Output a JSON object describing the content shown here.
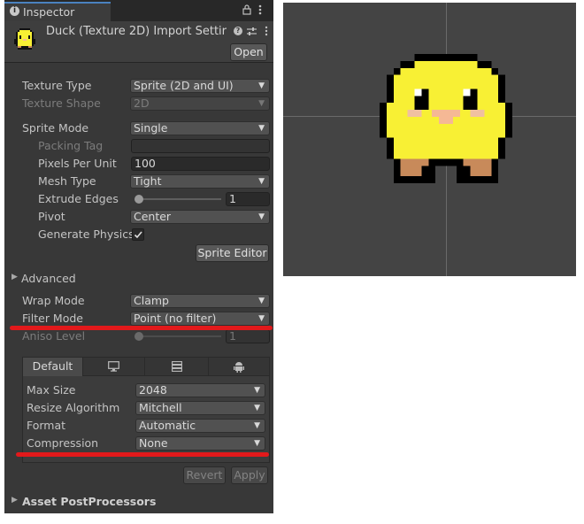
{
  "tab": {
    "icon": "info-icon",
    "title": "Inspector"
  },
  "header": {
    "title": "Duck (Texture 2D) Import Settir",
    "open_label": "Open"
  },
  "fields": {
    "texture_type": {
      "label": "Texture Type",
      "value": "Sprite (2D and UI)"
    },
    "texture_shape": {
      "label": "Texture Shape",
      "value": "2D"
    },
    "sprite_mode": {
      "label": "Sprite Mode",
      "value": "Single"
    },
    "packing_tag": {
      "label": "Packing Tag",
      "value": ""
    },
    "pixels_per_unit": {
      "label": "Pixels Per Unit",
      "value": "100"
    },
    "mesh_type": {
      "label": "Mesh Type",
      "value": "Tight"
    },
    "extrude_edges": {
      "label": "Extrude Edges",
      "value": "1"
    },
    "pivot": {
      "label": "Pivot",
      "value": "Center"
    },
    "generate_physics": {
      "label": "Generate Physics",
      "checked": true
    }
  },
  "sprite_editor_label": "Sprite Editor",
  "advanced_label": "Advanced",
  "wrap_mode": {
    "label": "Wrap Mode",
    "value": "Clamp"
  },
  "filter_mode": {
    "label": "Filter Mode",
    "value": "Point (no filter)"
  },
  "aniso_level": {
    "label": "Aniso Level",
    "value": "1"
  },
  "platform_tabs": [
    {
      "label": "Default",
      "icon": ""
    },
    {
      "label": "",
      "icon": "monitor-icon"
    },
    {
      "label": "",
      "icon": "server-icon"
    },
    {
      "label": "",
      "icon": "android-icon"
    }
  ],
  "platform": {
    "max_size": {
      "label": "Max Size",
      "value": "2048"
    },
    "resize_algorithm": {
      "label": "Resize Algorithm",
      "value": "Mitchell"
    },
    "format": {
      "label": "Format",
      "value": "Automatic"
    },
    "compression": {
      "label": "Compression",
      "value": "None"
    }
  },
  "revert_label": "Revert",
  "apply_label": "Apply",
  "postprocessors_label": "Asset PostProcessors",
  "colors": {
    "highlight": "#e2191b",
    "duck_body": "#f8f034",
    "duck_beak": "#f5b895",
    "preview_bg": "#444444"
  }
}
